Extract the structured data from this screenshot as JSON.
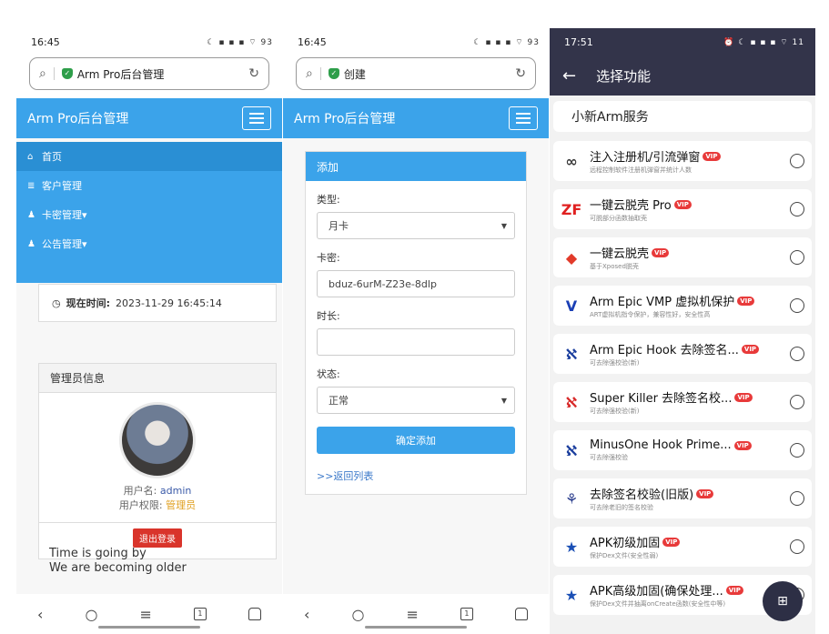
{
  "p1": {
    "status_time": "16:45",
    "status_right": "☾ ▪ ▪ ▪ ⌔ 93",
    "url": "Arm Pro后台管理",
    "header_title": "Arm Pro后台管理",
    "menu": [
      {
        "icon": "⌂",
        "label": "首页"
      },
      {
        "icon": "≣",
        "label": "客户管理"
      },
      {
        "icon": "♟",
        "label": "卡密管理▾"
      },
      {
        "icon": "♟",
        "label": "公告管理▾"
      }
    ],
    "time_label": "现在时间:",
    "time_value": "2023-11-29 16:45:14",
    "admin_title": "管理员信息",
    "username_label": "用户名:",
    "username_value": "admin",
    "perm_label": "用户权限:",
    "perm_value": "管理员",
    "logout": "退出登录",
    "quote_line1": "Time is going by",
    "quote_line2": "We are becoming older"
  },
  "p2": {
    "status_time": "16:45",
    "status_right": "☾ ▪ ▪ ▪ ⌔ 93",
    "url": "创建",
    "header_title": "Arm Pro后台管理",
    "form_title": "添加",
    "type_label": "类型:",
    "type_value": "月卡",
    "key_label": "卡密:",
    "key_value": "bduz-6urM-Z23e-8dlp",
    "duration_label": "时长:",
    "duration_value": "",
    "state_label": "状态:",
    "state_value": "正常",
    "submit": "确定添加",
    "back": ">>返回列表"
  },
  "p3": {
    "status_time": "17:51",
    "status_right": "⏰ ☾ ▪ ▪ ▪ ⌔ 11",
    "title": "选择功能",
    "service": "小新Arm服务",
    "vip": "VIP",
    "features": [
      {
        "icon": "∞",
        "color": "#3a3a3a",
        "title": "注入注册机/引流弹窗",
        "sub": "远程控制软件注册机弹窗并统计人数"
      },
      {
        "icon": "ZF",
        "color": "#e02020",
        "title": "一键云脱壳 Pro",
        "sub": "可脱部分函数抽取壳"
      },
      {
        "icon": "◆",
        "color": "#e23a2a",
        "title": "一键云脱壳",
        "sub": "基于Xposed脱壳"
      },
      {
        "icon": "V",
        "color": "#1a3fb5",
        "title": "Arm Epic VMP 虚拟机保护",
        "sub": "ART虚拟机指令保护，兼容性好，安全性高"
      },
      {
        "icon": "ℵ",
        "color": "#1c3f9e",
        "title": "Arm Epic Hook 去除签名...",
        "sub": "可去除强校验(新)"
      },
      {
        "icon": "ℵ",
        "color": "#d82a2a",
        "title": "Super Killer 去除签名校...",
        "sub": "可去除强校验(新)"
      },
      {
        "icon": "ℵ",
        "color": "#1c3f9e",
        "title": "MinusOne Hook Prime...",
        "sub": "可去除强校验"
      },
      {
        "icon": "⚘",
        "color": "#2c3f8e",
        "title": "去除签名校验(旧版)",
        "sub": "可去除老旧的签名校验"
      },
      {
        "icon": "★",
        "color": "#1a4fb5",
        "title": "APK初级加固",
        "sub": "保护Dex文件(安全性弱)"
      },
      {
        "icon": "★",
        "color": "#1a4fb5",
        "title": "APK高级加固(确保处理...",
        "sub": "保护Dex文件并抽离onCreate函数(安全性中等)"
      }
    ],
    "fab": "⊞"
  }
}
